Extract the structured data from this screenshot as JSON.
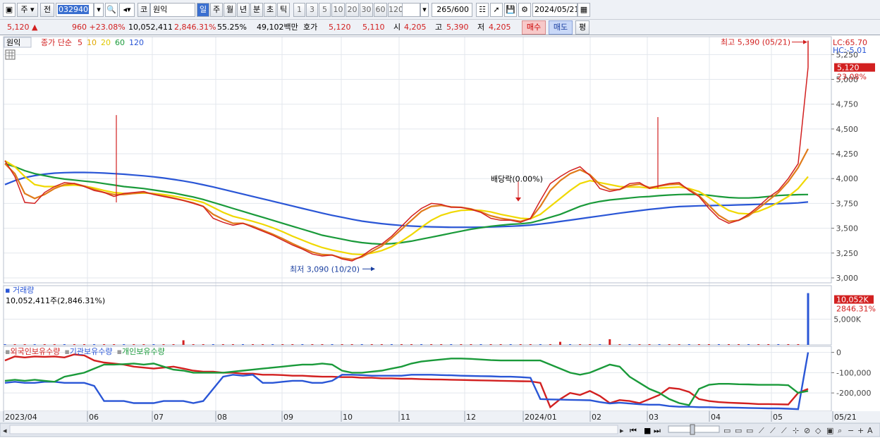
{
  "toolbar": {
    "period_type": "주",
    "prev_label": "전",
    "code": "032940",
    "market_label": "코",
    "name": "원익",
    "timeframes": [
      "일",
      "주",
      "월",
      "년",
      "분",
      "초",
      "틱"
    ],
    "timeframes_active": "일",
    "periods": [
      "1",
      "3",
      "5",
      "10",
      "20",
      "30",
      "60",
      "120"
    ],
    "count": "265",
    "count_max": "/600",
    "date": "2024/05/21"
  },
  "quote": {
    "price": "5,120",
    "arrow": "▲",
    "change": "960",
    "change_pct": "+23.08%",
    "volume": "10,052,411",
    "volume_ratio": "2,846.31%",
    "turnover": "55.25%",
    "amount": "49,102백만",
    "bid_label": "호가",
    "ask_price": "5,120",
    "bid_price": "5,110",
    "open_label": "시",
    "open": "4,205",
    "high_label": "고",
    "high": "5,390",
    "low_label": "저",
    "low": "4,205",
    "buy_label": "매수",
    "sell_label": "매도",
    "eval_label": "평"
  },
  "price_panel": {
    "tag": "원익",
    "legend_label": "종가 단순",
    "ma_names": [
      "5",
      "10",
      "20",
      "60",
      "120"
    ],
    "lc": "LC:65.70",
    "hc": "HC:-5.01",
    "last_price": "5,120",
    "last_pct": "23.08%",
    "max_annotation": "최고 5,390 (05/21)",
    "min_annotation": "최저 3,090 (10/20)",
    "dividend_annotation": "배당락(0.00%)"
  },
  "volume_panel": {
    "title": "거래량",
    "value_text": "10,052,411주(2,846.31%)",
    "last_value": "10,052K",
    "last_pct": "2846.31%"
  },
  "holdings_panel": {
    "legend": [
      "외국인보유수량",
      "기관보유수량",
      "개인보유수량"
    ]
  },
  "x_axis_labels": [
    "2023/04",
    "06",
    "07",
    "08",
    "09",
    "10",
    "11",
    "12",
    "2024/01",
    "02",
    "03",
    "04",
    "05",
    "05/21"
  ],
  "chart_data": [
    {
      "type": "line",
      "title": "원익 종가 단순",
      "ylim": [
        2950,
        5430
      ],
      "yticks": [
        "3,000",
        "3,250",
        "3,500",
        "3,750",
        "4,000",
        "4,250",
        "4,500",
        "4,750",
        "5,000",
        "5,250"
      ],
      "x_dates": [
        "2023/04",
        "06",
        "07",
        "08",
        "09",
        "10",
        "11",
        "12",
        "2024/01",
        "02",
        "03",
        "04",
        "05",
        "05/21"
      ],
      "series": [
        {
          "name": "종가",
          "color": "#d22020",
          "values": [
            4180,
            4020,
            3760,
            3750,
            3860,
            3920,
            3960,
            3950,
            3920,
            3880,
            3860,
            3820,
            3850,
            3860,
            3870,
            3840,
            3820,
            3800,
            3780,
            3750,
            3720,
            3600,
            3560,
            3530,
            3550,
            3510,
            3470,
            3430,
            3380,
            3330,
            3290,
            3240,
            3220,
            3230,
            3190,
            3170,
            3220,
            3290,
            3340,
            3420,
            3520,
            3620,
            3700,
            3750,
            3740,
            3710,
            3710,
            3690,
            3660,
            3600,
            3580,
            3580,
            3560,
            3600,
            3780,
            3950,
            4020,
            4080,
            4120,
            4030,
            3900,
            3870,
            3890,
            3950,
            3960,
            3900,
            3930,
            3950,
            3960,
            3880,
            3820,
            3700,
            3600,
            3550,
            3580,
            3640,
            3720,
            3810,
            3880,
            4000,
            4150,
            5120
          ]
        },
        {
          "name": "5",
          "color": "#e07b1a",
          "values": [
            4150,
            4050,
            3850,
            3800,
            3840,
            3900,
            3940,
            3950,
            3925,
            3890,
            3860,
            3840,
            3840,
            3850,
            3860,
            3845,
            3825,
            3805,
            3780,
            3755,
            3720,
            3640,
            3590,
            3550,
            3550,
            3520,
            3480,
            3440,
            3395,
            3345,
            3300,
            3260,
            3235,
            3230,
            3200,
            3185,
            3210,
            3265,
            3320,
            3400,
            3490,
            3580,
            3670,
            3720,
            3730,
            3715,
            3710,
            3695,
            3665,
            3625,
            3600,
            3585,
            3570,
            3595,
            3720,
            3880,
            3980,
            4050,
            4090,
            4040,
            3940,
            3890,
            3890,
            3930,
            3945,
            3910,
            3925,
            3940,
            3945,
            3890,
            3830,
            3730,
            3630,
            3570,
            3580,
            3625,
            3700,
            3780,
            3860,
            3970,
            4110,
            4300
          ]
        },
        {
          "name": "20",
          "color": "#f0d800",
          "values": [
            4180,
            4120,
            4020,
            3940,
            3920,
            3920,
            3930,
            3935,
            3925,
            3905,
            3880,
            3860,
            3850,
            3850,
            3855,
            3850,
            3840,
            3825,
            3805,
            3785,
            3760,
            3710,
            3660,
            3620,
            3595,
            3570,
            3540,
            3505,
            3465,
            3420,
            3380,
            3340,
            3305,
            3280,
            3260,
            3240,
            3235,
            3250,
            3275,
            3315,
            3370,
            3435,
            3510,
            3580,
            3630,
            3660,
            3680,
            3685,
            3680,
            3665,
            3640,
            3620,
            3600,
            3595,
            3640,
            3720,
            3800,
            3880,
            3950,
            3980,
            3960,
            3940,
            3920,
            3915,
            3915,
            3905,
            3905,
            3910,
            3915,
            3900,
            3870,
            3810,
            3740,
            3680,
            3650,
            3645,
            3670,
            3710,
            3760,
            3820,
            3900,
            4020
          ]
        },
        {
          "name": "60",
          "color": "#1a9a3a",
          "values": [
            4150,
            4120,
            4080,
            4050,
            4030,
            4010,
            3995,
            3985,
            3975,
            3965,
            3950,
            3935,
            3920,
            3910,
            3900,
            3885,
            3870,
            3855,
            3835,
            3815,
            3790,
            3760,
            3730,
            3700,
            3670,
            3640,
            3610,
            3580,
            3550,
            3520,
            3490,
            3460,
            3430,
            3410,
            3390,
            3370,
            3355,
            3345,
            3340,
            3345,
            3355,
            3370,
            3390,
            3410,
            3430,
            3450,
            3470,
            3490,
            3505,
            3520,
            3530,
            3540,
            3545,
            3555,
            3580,
            3610,
            3640,
            3680,
            3720,
            3750,
            3770,
            3785,
            3795,
            3805,
            3815,
            3820,
            3828,
            3835,
            3840,
            3842,
            3840,
            3832,
            3820,
            3810,
            3805,
            3805,
            3810,
            3820,
            3830,
            3835,
            3838,
            3840
          ]
        },
        {
          "name": "120",
          "color": "#2a56d6",
          "values": [
            3940,
            3980,
            4010,
            4030,
            4045,
            4055,
            4060,
            4062,
            4062,
            4060,
            4056,
            4050,
            4044,
            4036,
            4028,
            4018,
            4006,
            3992,
            3976,
            3958,
            3938,
            3916,
            3892,
            3868,
            3844,
            3820,
            3796,
            3772,
            3748,
            3724,
            3700,
            3676,
            3652,
            3630,
            3610,
            3590,
            3572,
            3558,
            3546,
            3536,
            3528,
            3522,
            3518,
            3514,
            3512,
            3510,
            3510,
            3510,
            3511,
            3513,
            3516,
            3520,
            3525,
            3532,
            3542,
            3554,
            3568,
            3582,
            3596,
            3610,
            3624,
            3638,
            3652,
            3665,
            3678,
            3690,
            3700,
            3710,
            3718,
            3722,
            3726,
            3728,
            3730,
            3732,
            3735,
            3738,
            3741,
            3744,
            3747,
            3750,
            3755,
            3765
          ]
        }
      ]
    },
    {
      "type": "bar",
      "title": "거래량",
      "ylim": [
        0,
        11500
      ],
      "yticks": [
        "5,000K"
      ],
      "units": "K",
      "values": [
        80,
        60,
        70,
        50,
        60,
        55,
        65,
        60,
        60,
        50,
        40,
        50,
        60,
        50,
        50,
        45,
        40,
        55,
        45,
        50,
        45,
        60,
        40,
        50,
        45,
        45,
        40,
        45,
        50,
        55,
        40,
        45,
        50,
        40,
        45,
        50,
        55,
        60,
        45,
        50,
        50,
        45,
        50,
        45,
        40,
        45,
        50,
        40,
        45,
        45,
        50,
        45,
        45,
        55,
        60,
        80,
        600,
        70,
        90,
        60,
        60,
        1100,
        50,
        60,
        70,
        40,
        50,
        50,
        60,
        50,
        50,
        40,
        60,
        45,
        50,
        55,
        50,
        60,
        60,
        70,
        90,
        10052
      ],
      "spikes": [
        {
          "index": 18,
          "value": 900
        }
      ]
    },
    {
      "type": "line",
      "title": "보유수량",
      "ylim": [
        -290000,
        30000
      ],
      "yticks": [
        "0",
        "-100,000",
        "-200,000"
      ],
      "series": [
        {
          "name": "외국인보유수량",
          "color": "#d22020",
          "values": [
            -40000,
            -20000,
            -25000,
            -20000,
            -22000,
            -20000,
            -25000,
            -10000,
            -15000,
            -40000,
            -50000,
            -55000,
            -60000,
            -70000,
            -75000,
            -80000,
            -75000,
            -70000,
            -80000,
            -90000,
            -95000,
            -95000,
            -100000,
            -100000,
            -105000,
            -105000,
            -110000,
            -110000,
            -112000,
            -115000,
            -115000,
            -118000,
            -120000,
            -120000,
            -122000,
            -122000,
            -125000,
            -125000,
            -128000,
            -128000,
            -130000,
            -130000,
            -132000,
            -133000,
            -134000,
            -135000,
            -136000,
            -137000,
            -138000,
            -139000,
            -140000,
            -141000,
            -142000,
            -143000,
            -150000,
            -270000,
            -230000,
            -200000,
            -210000,
            -190000,
            -215000,
            -250000,
            -235000,
            -240000,
            -250000,
            -230000,
            -210000,
            -175000,
            -180000,
            -195000,
            -230000,
            -240000,
            -245000,
            -248000,
            -250000,
            -252000,
            -255000,
            -255000,
            -256000,
            -257000,
            -200000,
            -180000
          ]
        },
        {
          "name": "기관보유수량",
          "color": "#2a56d6",
          "values": [
            -150000,
            -145000,
            -150000,
            -150000,
            -145000,
            -145000,
            -150000,
            -150000,
            -150000,
            -165000,
            -240000,
            -240000,
            -240000,
            -250000,
            -250000,
            -250000,
            -240000,
            -240000,
            -240000,
            -250000,
            -240000,
            -180000,
            -120000,
            -110000,
            -115000,
            -110000,
            -150000,
            -150000,
            -145000,
            -140000,
            -140000,
            -150000,
            -150000,
            -140000,
            -110000,
            -110000,
            -112000,
            -115000,
            -115000,
            -115000,
            -115000,
            -110000,
            -110000,
            -110000,
            -112000,
            -113000,
            -115000,
            -116000,
            -117000,
            -118000,
            -120000,
            -120000,
            -122000,
            -125000,
            -230000,
            -232000,
            -233000,
            -234000,
            -235000,
            -236000,
            -245000,
            -252000,
            -248000,
            -252000,
            -256000,
            -258000,
            -258000,
            -265000,
            -268000,
            -268000,
            -270000,
            -270000,
            -272000,
            -272000,
            -273000,
            -274000,
            -275000,
            -276000,
            -276000,
            -278000,
            -280000,
            0
          ]
        },
        {
          "name": "개인보유수량",
          "color": "#1a9a3a",
          "values": [
            -140000,
            -135000,
            -140000,
            -135000,
            -140000,
            -145000,
            -120000,
            -110000,
            -100000,
            -80000,
            -60000,
            -60000,
            -58000,
            -55000,
            -60000,
            -55000,
            -70000,
            -85000,
            -90000,
            -100000,
            -100000,
            -100000,
            -100000,
            -95000,
            -90000,
            -85000,
            -80000,
            -75000,
            -70000,
            -65000,
            -60000,
            -60000,
            -55000,
            -60000,
            -90000,
            -100000,
            -100000,
            -95000,
            -90000,
            -80000,
            -70000,
            -55000,
            -45000,
            -40000,
            -35000,
            -30000,
            -30000,
            -32000,
            -35000,
            -38000,
            -40000,
            -40000,
            -40000,
            -40000,
            -40000,
            -60000,
            -80000,
            -100000,
            -110000,
            -100000,
            -80000,
            -60000,
            -70000,
            -120000,
            -150000,
            -180000,
            -200000,
            -230000,
            -250000,
            -260000,
            -180000,
            -160000,
            -155000,
            -155000,
            -157000,
            -158000,
            -160000,
            -160000,
            -160000,
            -162000,
            -200000,
            -190000
          ]
        }
      ]
    }
  ]
}
